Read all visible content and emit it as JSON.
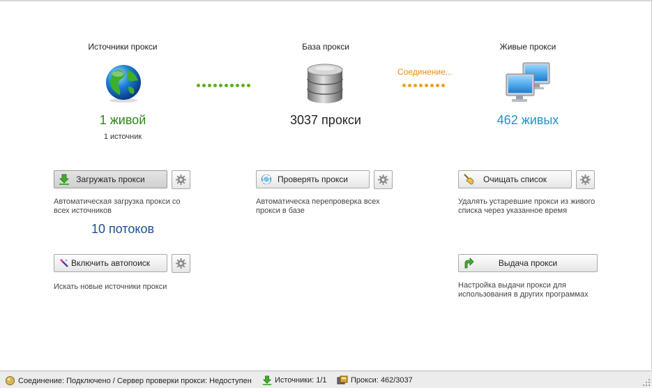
{
  "sources": {
    "title": "Источники прокси",
    "count": "1 живой",
    "sub": "1 источник",
    "load_button": "Загружать прокси",
    "load_desc": "Автоматическая загрузка прокси со всех источников",
    "threads": "10 потоков",
    "autosearch_button": "Включить автопоиск",
    "autosearch_desc": "Искать новые источники прокси"
  },
  "base": {
    "title": "База прокси",
    "count": "3037 прокси",
    "check_button": "Проверять прокси",
    "check_desc": "Автоматическа перепроверка всех прокси в базе"
  },
  "live": {
    "title": "Живые прокси",
    "count": "462 живых",
    "connection": "Соединение...",
    "clear_button": "Очищать список",
    "clear_desc": "Удалять устаревшие прокси из живого списка через указанное время",
    "issue_button": "Выдача прокси",
    "issue_desc": "Настройка выдачи прокси для использования в других программах"
  },
  "status": {
    "connection": "Соединение: Подключено / Сервер проверки прокси: Недоступен",
    "sources": "Источники: 1/1",
    "proxies": "Прокси: 462/3037"
  },
  "colors": {
    "green": "#2a8a12",
    "blue": "#1e93c8",
    "orange": "#ef8a00",
    "navy": "#1f4b9a"
  }
}
